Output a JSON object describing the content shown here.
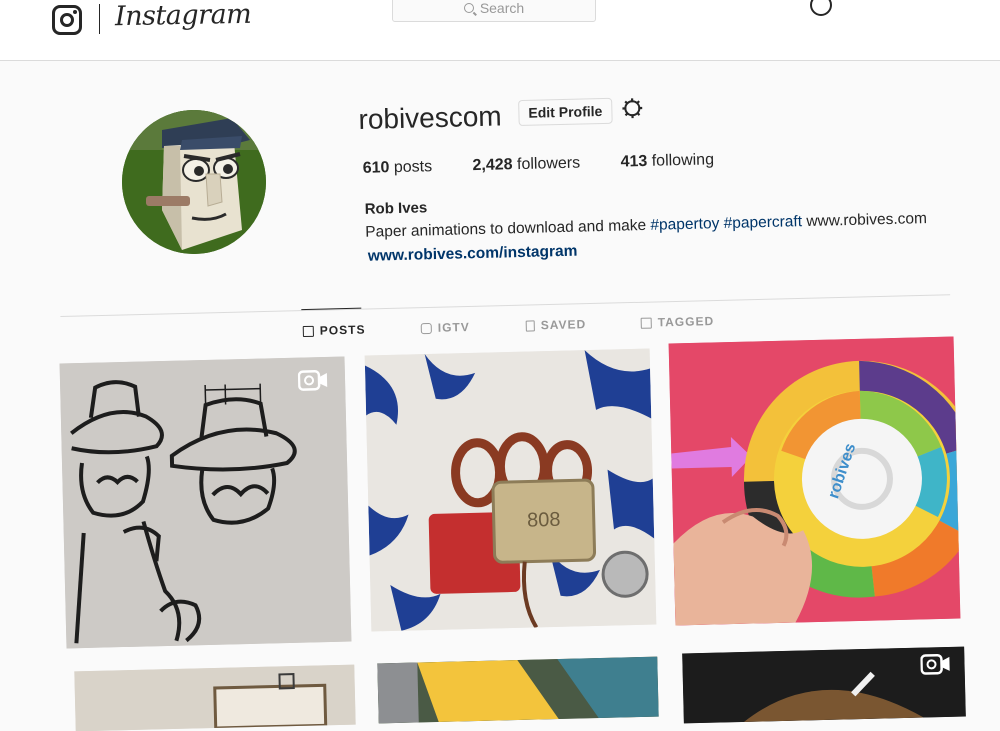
{
  "header": {
    "wordmark": "Instagram",
    "search_placeholder": "Search"
  },
  "profile": {
    "username": "robivescom",
    "edit_profile_label": "Edit Profile",
    "stats": {
      "posts_count": "610",
      "posts_label": "posts",
      "followers_count": "2,428",
      "followers_label": "followers",
      "following_count": "413",
      "following_label": "following"
    },
    "name": "Rob Ives",
    "bio_prefix": "Paper animations to download and make",
    "bio_tag1": "#papertoy",
    "bio_tag2": "#papercraft",
    "bio_suffix": "www.robives.com",
    "link": "www.robives.com/instagram"
  },
  "tabs": [
    {
      "label": "POSTS",
      "icon": "grid-icon",
      "active": true
    },
    {
      "label": "IGTV",
      "icon": "igtv-icon",
      "active": false
    },
    {
      "label": "SAVED",
      "icon": "bookmark-icon",
      "active": false
    },
    {
      "label": "TAGGED",
      "icon": "tagged-icon",
      "active": false
    }
  ],
  "posts": [
    {
      "type": "video",
      "icon": "video-icon"
    },
    {
      "type": "image"
    },
    {
      "type": "image",
      "wheel_text": "robives"
    },
    {
      "type": "image"
    },
    {
      "type": "image"
    },
    {
      "type": "video",
      "icon": "video-icon"
    }
  ],
  "colors": {
    "link": "#003569",
    "text": "#262626",
    "muted": "#999999",
    "border": "#dbdbdb"
  }
}
